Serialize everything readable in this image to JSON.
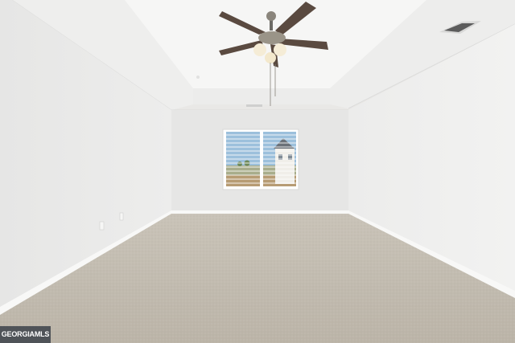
{
  "watermark": {
    "text": "GEORGIAMLS"
  },
  "colors": {
    "ceiling": "#f4f4f3",
    "left_wall": "#ebebea",
    "right_wall": "#efefee",
    "back_wall": "#e7e7e6",
    "carpet": "#c3bcb1",
    "baseboard": "#f7f7f6",
    "fan_blade": "#5a4a40",
    "fan_body": "#8a857c",
    "light_glass": "#f4e9cf",
    "window_frame": "#ffffff",
    "sky": "#8fb8d6"
  },
  "objects": {
    "ceiling_fan": "ceiling-fan-icon",
    "window": "window-with-blinds",
    "air_vent": "ceiling-vent-icon",
    "outlets": "wall-outlet-icon"
  }
}
